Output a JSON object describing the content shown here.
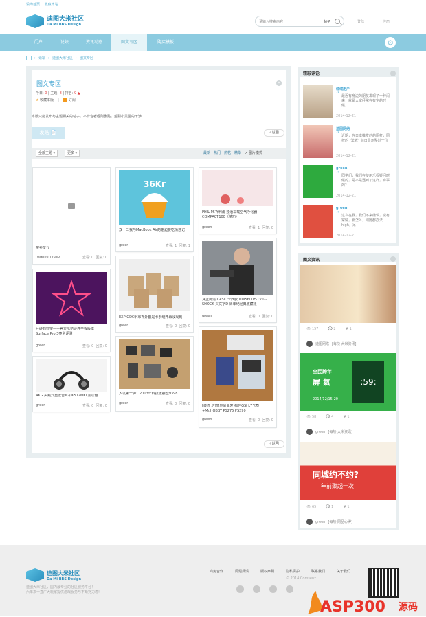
{
  "topbar": {
    "set_home": "设为首页",
    "bookmark": "收藏本站"
  },
  "logo": {
    "name": "迪图大米社区",
    "sub": "Da Mi BBS Design"
  },
  "search": {
    "placeholder": "请输入搜索内容",
    "scope": "帖子"
  },
  "auth": {
    "login": "登陆",
    "register": "注册"
  },
  "nav": [
    {
      "label": "门户"
    },
    {
      "label": "论坛"
    },
    {
      "label": "资讯动态"
    },
    {
      "label": "图文专区"
    },
    {
      "label": "购买模板"
    }
  ],
  "breadcrumb": [
    "论坛",
    "迪图大米社区",
    "图文专区"
  ],
  "forum": {
    "title": "图文专区",
    "today_label": "今日:",
    "today": "0",
    "topics_label": "主题:",
    "topics": "8",
    "rank_label": "排名:",
    "rank": "9",
    "favorite": "收藏本版",
    "subscribe": "订阅",
    "description": "本版只能发布与主题相关的帖子，不符合者经则删贴，望别小黑屋的干涉",
    "post_button": "发贴",
    "back_button": "返回"
  },
  "filters": {
    "all_topics": "全部主题",
    "more": "更多",
    "tabs": [
      "最新",
      "热门",
      "热帖",
      "精华"
    ],
    "image_mode": "图片模式"
  },
  "posts": [
    {
      "caption": "买卖交代",
      "user": "rosemerrygao",
      "views": "查看: 0",
      "replies": "回复: 0"
    },
    {
      "caption": "巨硬的野望——官方示范硬件平板版本Surface Pro 3亮全评测",
      "user": "green",
      "views": "查看: 0",
      "replies": "回复: 0"
    },
    {
      "caption": "AKG 头戴式重低音耳机K512MKII黑灰色",
      "user": "green",
      "views": "查看: 0",
      "replies": "回复: 0"
    },
    {
      "caption": "双十二我与MacBook Air的邂逅要吃情违记",
      "user": "green",
      "views": "查看: 1",
      "replies": "回复: 1"
    },
    {
      "caption": "EXP GDC帆布布外套是卡系统开幕及观刺",
      "user": "green",
      "views": "查看: 0",
      "replies": "回复: 0"
    },
    {
      "caption": "入坑第一弹：2013年科技旗舰型9398",
      "user": "green",
      "views": "查看: 0",
      "replies": "回复: 0"
    },
    {
      "caption": "PHILIPS飞利浦 独治车载空气净化器COMPACT100（精巧）",
      "user": "green",
      "views": "查看: 1",
      "replies": "回复: 0"
    },
    {
      "caption": "真正铸造 CASIO卡西欧 DW5600E-1V G-SHOCK 头文字D 周年纪经典收藏帳",
      "user": "green",
      "views": "查看: 0",
      "replies": "回复: 0"
    },
    {
      "caption": "[装修 培育]应尚菁发 都住GSI L7气质+Mr.HOBBY PS275 PS290",
      "user": "green",
      "views": "查看: 0",
      "replies": "回复: 0"
    }
  ],
  "comments": {
    "title": "精彩评论",
    "items": [
      {
        "name": "绒绒用户",
        "text": "最近有身边的朋友发现了一种闹来：就是大家经常在有空的时候，",
        "date": "2014-12-21"
      },
      {
        "name": "迪图网络",
        "text": "近期，在日本推发的的图杆，同校的 \"法老\" 前日显示整过一位",
        "date": "2014-12-21"
      },
      {
        "name": "green",
        "text": "同学们，我们在使用乐视疑问时候的，是不是遇到了这样，麻事的？",
        "date": "2014-12-21"
      },
      {
        "name": "green",
        "text": "这次在我，我们不来编辑，说有常情，那怎么，则她都办法high，呆",
        "date": "2014-12-21"
      }
    ]
  },
  "news": {
    "title": "图文资讯",
    "items": [
      {
        "views": "157",
        "comments": "2",
        "likes": "1",
        "user": "迪图网络",
        "tag": "[每块·大米资讯]"
      },
      {
        "views": "58",
        "comments": "4",
        "likes": "1",
        "user": "green",
        "tag": "[每块·大米资讯]"
      },
      {
        "views": "65",
        "comments": "1",
        "likes": "1",
        "user": "green",
        "tag": "[每块·同品心得]"
      }
    ],
    "banner2_line1": "全民跨年",
    "banner2_line2": "屏  氣",
    "banner2_date": "2014/12/15-20",
    "banner2_clock": ":59:",
    "banner3_line1": "同城约不约?",
    "banner3_line2": "年前聚起一次"
  },
  "footer": {
    "logo": "迪图大米社区",
    "sub": "Da Mi BBS Design",
    "desc1": "迪图大米社区，国内最专业的社区服务平台！",
    "desc2": "六年来一直广大玩家提供游戏服务与不断努力着!",
    "links": [
      "商务合作",
      "问题反馈",
      "版权声明",
      "隐私保护",
      "联系我们",
      "关于我们"
    ],
    "copyright": "© 2014 Comsenz"
  },
  "watermark": {
    "brand": "ASP300",
    "suffix": "源码"
  },
  "colors": {
    "accent": "#3fa4d2",
    "nav": "#8ccbe0",
    "red": "#e04040"
  }
}
